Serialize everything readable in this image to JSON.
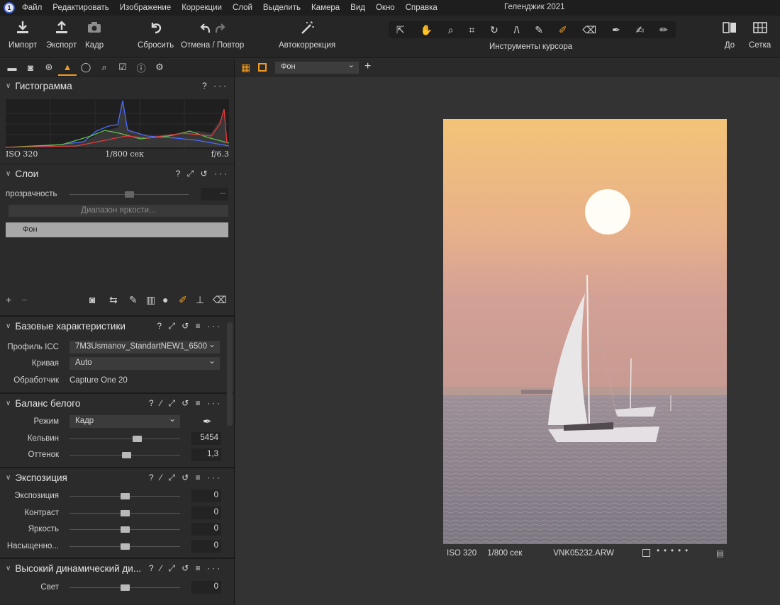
{
  "menu": {
    "items": [
      "Файл",
      "Редактировать",
      "Изображение",
      "Коррекции",
      "Слой",
      "Выделить",
      "Камера",
      "Вид",
      "Окно",
      "Справка"
    ],
    "window_title": "Геленджик 2021"
  },
  "toolbar": {
    "import": "Импорт",
    "export": "Экспорт",
    "capture": "Кадр",
    "reset": "Сбросить",
    "undo_redo": "Отмена / Повтор",
    "autocorrect": "Автокоррекция",
    "cursor_tools": "Инструменты курсора",
    "before": "До",
    "grid": "Сетка"
  },
  "histogram": {
    "title": "Гистограмма",
    "iso": "ISO 320",
    "shutter": "1/800 сек",
    "aperture": "f/6.3"
  },
  "layers": {
    "title": "Слои",
    "opacity_label": "прозрачность",
    "opacity_value": "--",
    "luma_range": "Диапазон яркости...",
    "layer_name": "Фон"
  },
  "basic": {
    "title": "Базовые характеристики",
    "icc_label": "Профиль ICC",
    "icc_value": "7M3Usmanov_StandartNEW1_6500",
    "curve_label": "Кривая",
    "curve_value": "Auto",
    "engine_label": "Обработчик",
    "engine_value": "Capture One 20"
  },
  "wb": {
    "title": "Баланс белого",
    "mode_label": "Режим",
    "mode_value": "Кадр",
    "kelvin_label": "Кельвин",
    "kelvin_value": "5454",
    "tint_label": "Оттенок",
    "tint_value": "1,3"
  },
  "exposure": {
    "title": "Экспозиция",
    "exposure_label": "Экспозиция",
    "exposure_value": "0",
    "contrast_label": "Контраст",
    "contrast_value": "0",
    "brightness_label": "Яркость",
    "brightness_value": "0",
    "saturation_label": "Насыщенно...",
    "saturation_value": "0"
  },
  "hdr": {
    "title": "Высокий динамический ди...",
    "highlight_label": "Свет",
    "highlight_value": "0"
  },
  "viewer": {
    "layer_select": "Фон",
    "iso": "ISO 320",
    "shutter": "1/800 сек",
    "filename": "VNK05232.ARW"
  }
}
